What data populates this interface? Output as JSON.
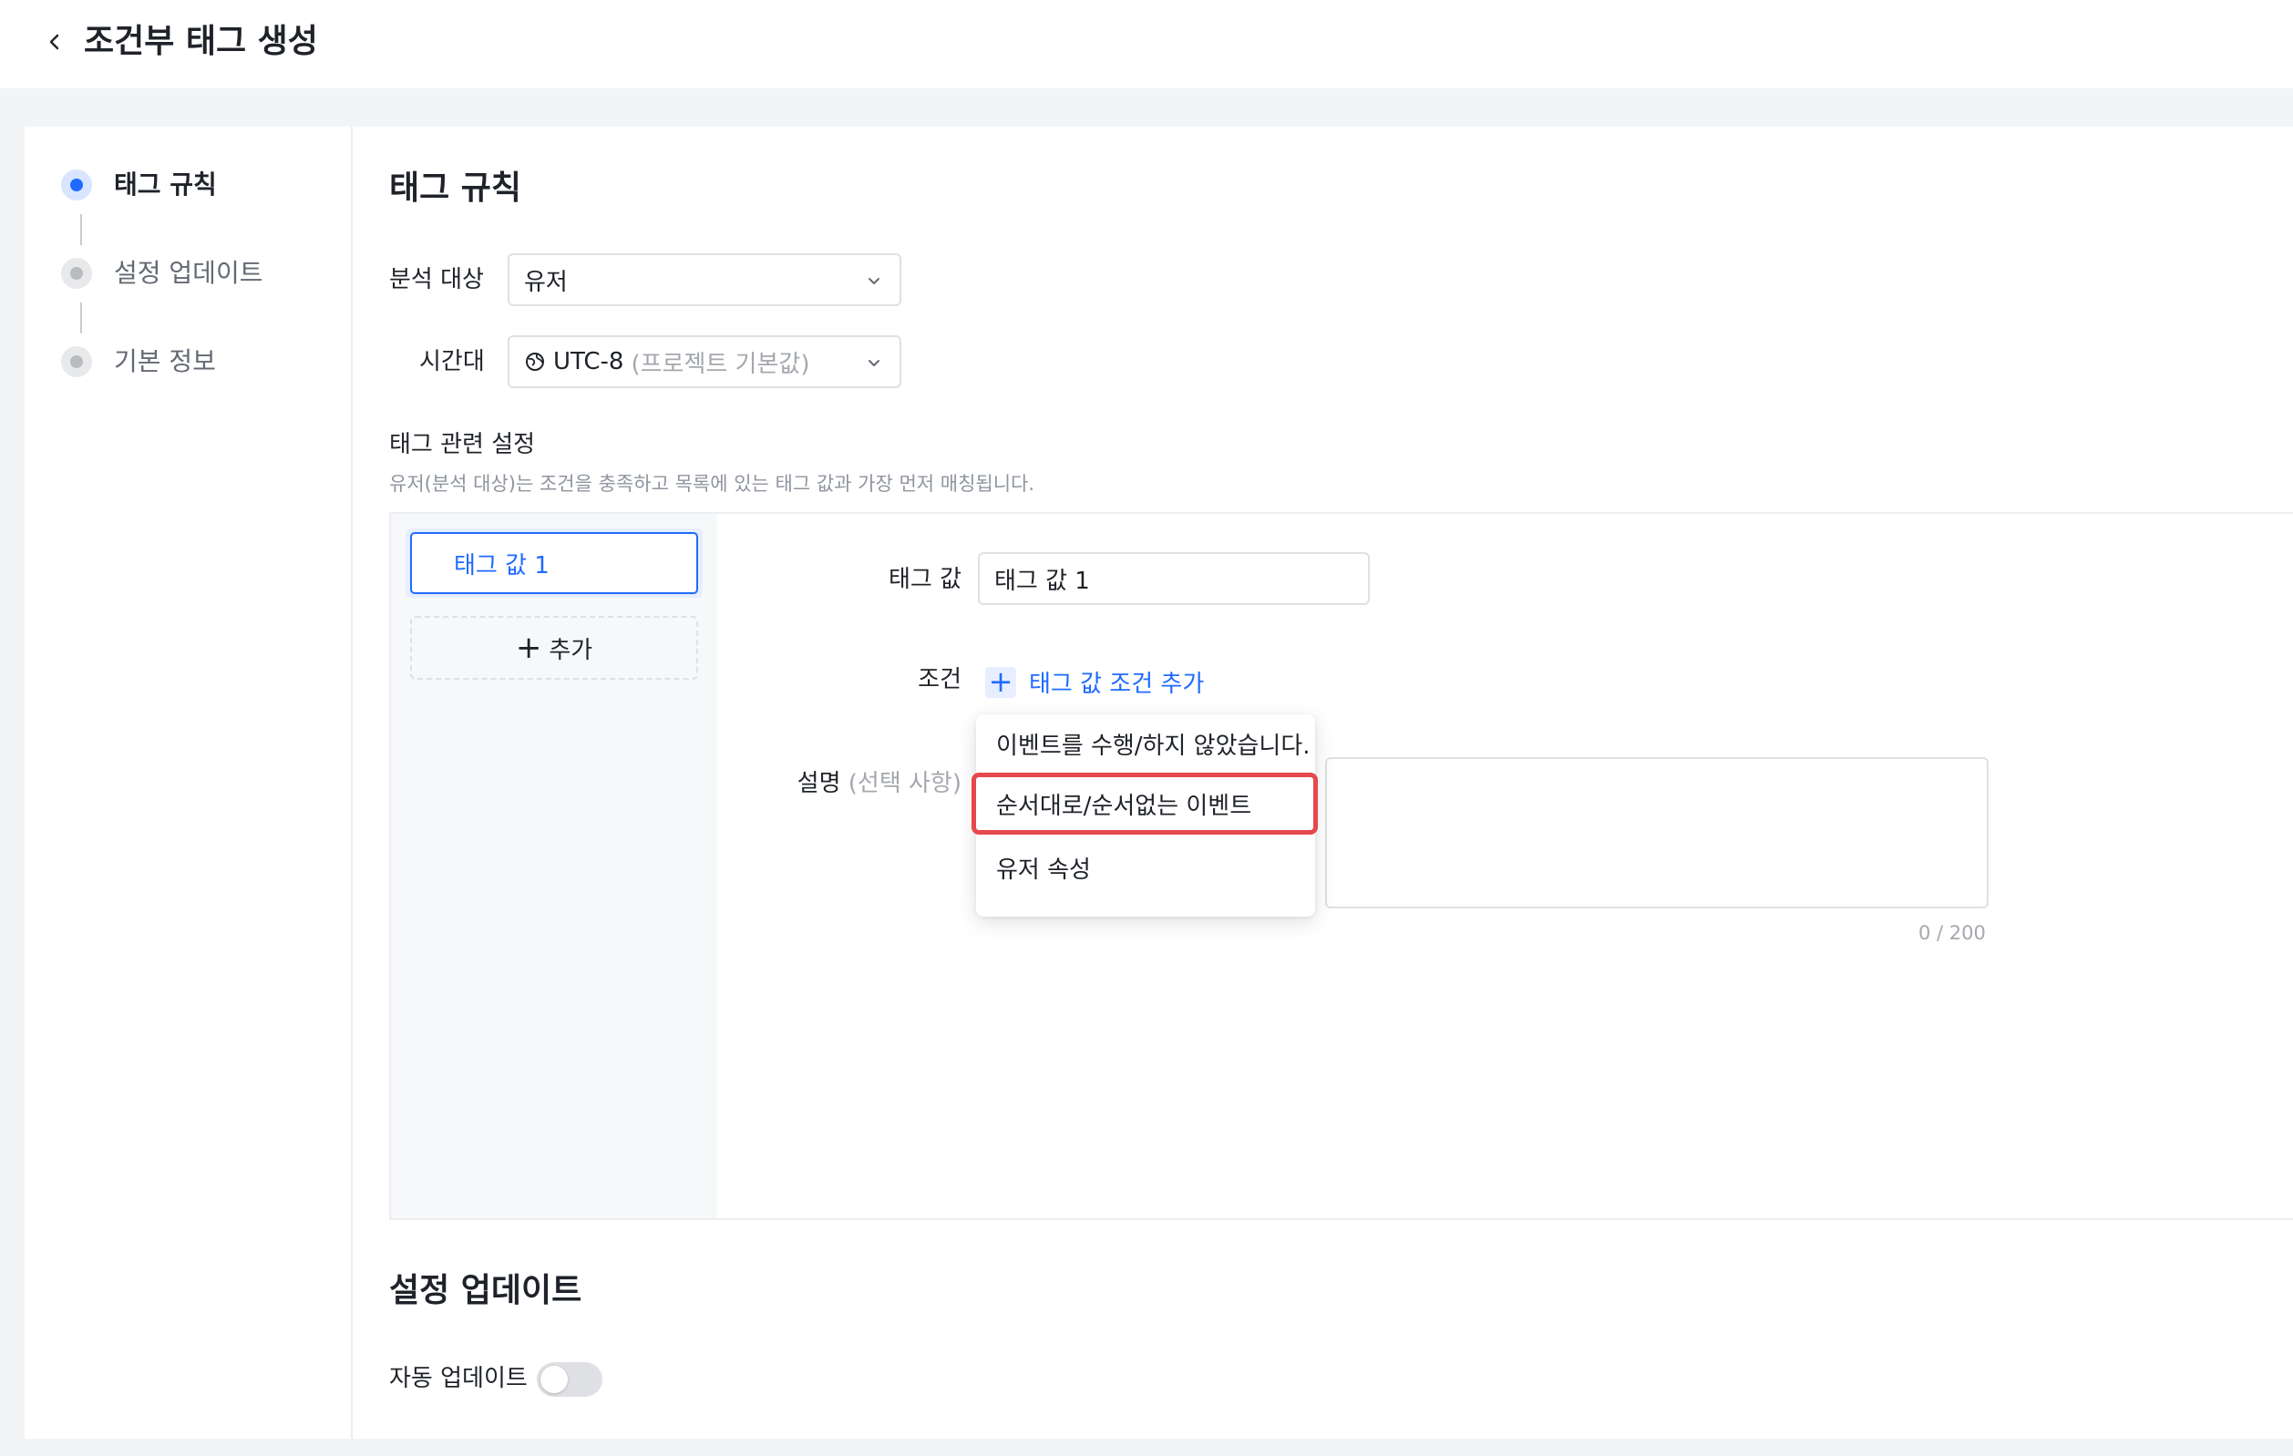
{
  "header": {
    "title": "조건부 태그 생성"
  },
  "steps": [
    {
      "label": "태그 규칙",
      "state": "active"
    },
    {
      "label": "설정 업데이트",
      "state": "idle"
    },
    {
      "label": "기본 정보",
      "state": "idle"
    }
  ],
  "rules": {
    "title": "태그 규칙",
    "analysis_target": {
      "label": "분석 대상",
      "value": "유저"
    },
    "timezone": {
      "label": "시간대",
      "value": "UTC-8",
      "suffix": "(프로젝트 기본값)"
    },
    "tag_settings": {
      "title": "태그 관련 설정",
      "hint": "유저(분석 대상)는 조건을 충족하고 목록에 있는 태그 값과 가장 먼저 매칭됩니다.",
      "tags": [
        {
          "label": "태그 값 1"
        }
      ],
      "add_label": "추가",
      "detail": {
        "tag_value_label": "태그 값",
        "tag_value": "태그 값 1",
        "condition_label": "조건",
        "add_condition_label": "태그 값 조건 추가",
        "description_label": "설명",
        "description_optional": "(선택 사항)",
        "counter": "0 / 200"
      },
      "condition_menu": [
        "이벤트를 수행/하지 않았습니다.",
        "순서대로/순서없는 이벤트",
        "유저 속성"
      ]
    }
  },
  "settings_update": {
    "title": "설정 업데이트",
    "auto_update_label": "자동 업데이트",
    "auto_update": false
  },
  "colors": {
    "accent": "#1f6bff",
    "highlight": "#e5484d"
  }
}
